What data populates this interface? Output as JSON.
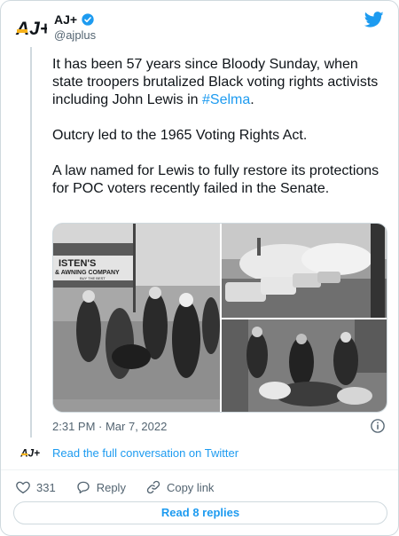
{
  "account": {
    "name": "AJ+",
    "handle": "@ajplus",
    "logo_text": "AJ+"
  },
  "tweet": {
    "text_part1": "It has been 57 years since Bloody Sunday, when state troopers brutalized Black voting rights activists including John Lewis in ",
    "hashtag": "#Selma",
    "text_part1_end": ".",
    "paragraph2": "Outcry led to the 1965 Voting Rights Act.",
    "paragraph3": "A law named for Lewis to fully restore its protections for POC voters recently failed in the Senate."
  },
  "media": {
    "photos": [
      {
        "sign_line1": "ISTEN'S",
        "sign_line2": "& AWNING COMPANY",
        "sign_line3": "BUY THE BEST"
      },
      {},
      {}
    ]
  },
  "meta": {
    "timestamp": "2:31 PM · Mar 7, 2022"
  },
  "conversation": {
    "link_text": "Read the full conversation on Twitter"
  },
  "actions": {
    "likes": "331",
    "reply_label": "Reply",
    "copy_label": "Copy link"
  },
  "replies_button": "Read 8 replies",
  "colors": {
    "accent": "#1d9bf0",
    "text": "#0f1419",
    "muted": "#536471",
    "border": "#cfd9de"
  }
}
